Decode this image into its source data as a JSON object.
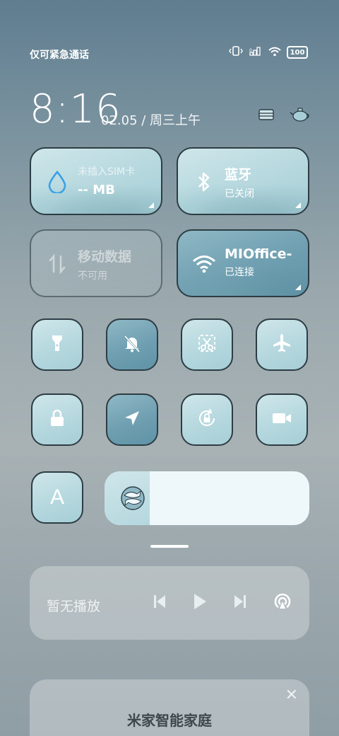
{
  "status_bar": {
    "carrier": "仅可紧急通话",
    "battery": "100",
    "icons": [
      "vibrate-icon",
      "signal-icon",
      "wifi-icon",
      "battery-icon"
    ]
  },
  "clock": {
    "time": "8:16",
    "date": "02.05 / 周三上午"
  },
  "top_right_icons": [
    "edit-tiles-icon",
    "teapot-theme-icon"
  ],
  "big_tiles": {
    "data_usage": {
      "title": "未插入SIM卡",
      "value": "-- MB",
      "icon": "water-drop-icon"
    },
    "bluetooth": {
      "title": "蓝牙",
      "sub": "已关闭",
      "icon": "bluetooth-icon"
    },
    "mobile_data": {
      "title": "移动数据",
      "sub": "不可用",
      "icon": "mobile-data-icon"
    },
    "wifi": {
      "title": "MIOffice-",
      "sub": "已连接",
      "icon": "wifi-icon"
    }
  },
  "toggles_row1": [
    {
      "name": "flashlight",
      "icon": "flashlight-icon",
      "active": false
    },
    {
      "name": "mute",
      "icon": "bell-off-icon",
      "active": true
    },
    {
      "name": "screenshot",
      "icon": "scissors-icon",
      "active": false
    },
    {
      "name": "airplane",
      "icon": "airplane-icon",
      "active": false
    }
  ],
  "toggles_row2": [
    {
      "name": "lock",
      "icon": "lock-icon",
      "active": false
    },
    {
      "name": "location",
      "icon": "location-arrow-icon",
      "active": true
    },
    {
      "name": "rotation-lock",
      "icon": "rotation-lock-icon",
      "active": false
    },
    {
      "name": "screen-record",
      "icon": "video-camera-icon",
      "active": false
    }
  ],
  "auto_brightness": {
    "label": "A"
  },
  "brightness": {
    "level": 0.22,
    "thumb_icon": "fish-icon"
  },
  "media": {
    "title": "暂无播放",
    "controls": [
      "previous-icon",
      "play-icon",
      "next-icon",
      "cast-icon"
    ]
  },
  "smart_home": {
    "title": "米家智能家庭",
    "close": "✕"
  },
  "colors": {
    "tile_light": "#b7d9df",
    "tile_dark": "#6f9fb1",
    "accent_blue": "#3ba1e6"
  }
}
